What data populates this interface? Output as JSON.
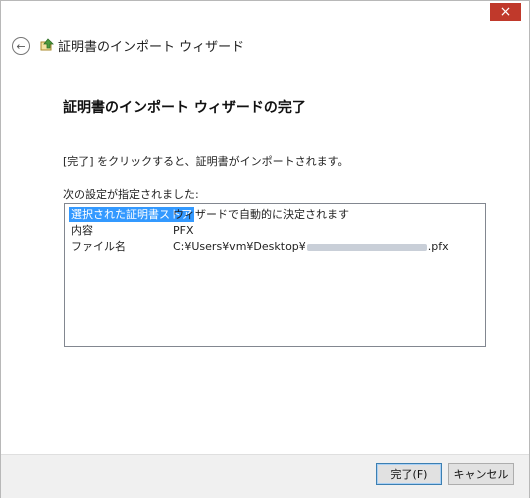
{
  "window": {
    "close_glyph": "×"
  },
  "header": {
    "title": "証明書のインポート ウィザード",
    "back_icon": "back-arrow-icon",
    "wizard_icon": "certificate-wizard-icon"
  },
  "main": {
    "heading": "証明書のインポート ウィザードの完了",
    "instruction": "[完了] をクリックすると、証明書がインポートされます。",
    "settings_label": "次の設定が指定されました:",
    "settings": [
      {
        "key": "選択された証明書ストア",
        "value": "ウィザードで自動的に決定されます"
      },
      {
        "key": "内容",
        "value": "PFX"
      },
      {
        "key": "ファイル名",
        "value_prefix": "C:¥Users¥vm¥Desktop¥",
        "value_suffix": ".pfx"
      }
    ]
  },
  "footer": {
    "finish_label": "完了(F)",
    "cancel_label": "キャンセル"
  },
  "colors": {
    "close_button": "#c0392b",
    "selection": "#3399ff"
  }
}
